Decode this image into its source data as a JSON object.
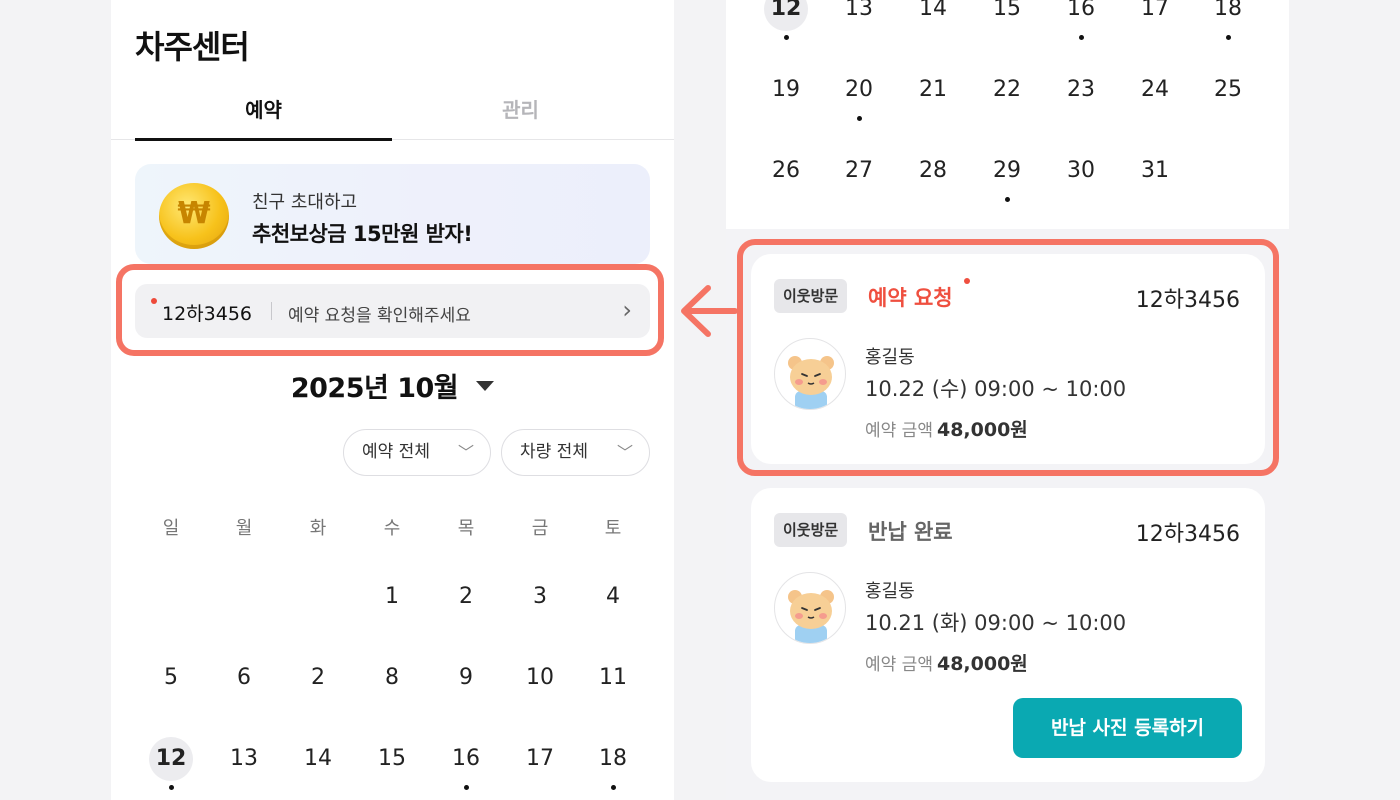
{
  "left": {
    "title": "차주센터",
    "tabs": [
      {
        "label": "예약",
        "active": true
      },
      {
        "label": "관리",
        "active": false
      }
    ],
    "promo": {
      "line1": "친구 초대하고",
      "line2": "추천보상금 15만원 받자!",
      "coin_symbol": "₩"
    },
    "notice": {
      "plate": "12하3456",
      "message": "예약 요청을 확인해주세요",
      "chevron": "›"
    },
    "month": "2025년 10월",
    "filters": [
      {
        "label": "예약 전체"
      },
      {
        "label": "차량 전체"
      }
    ],
    "weekdays": [
      "일",
      "월",
      "화",
      "수",
      "목",
      "금",
      "토"
    ],
    "calendar_rows": [
      [
        null,
        null,
        null,
        "1",
        "2",
        "3",
        "4"
      ],
      [
        "5",
        "6",
        "2",
        "8",
        "9",
        "10",
        "11"
      ],
      [
        "12",
        "13",
        "14",
        "15",
        "16",
        "17",
        "18"
      ]
    ],
    "today": "12",
    "dotted_days": [
      "12",
      "16",
      "18"
    ]
  },
  "right": {
    "calendar_rows": [
      [
        "12",
        "13",
        "14",
        "15",
        "16",
        "17",
        "18"
      ],
      [
        "19",
        "20",
        "21",
        "22",
        "23",
        "24",
        "25"
      ],
      [
        "26",
        "27",
        "28",
        "29",
        "30",
        "31",
        null
      ]
    ],
    "today": "12",
    "dotted_days": [
      "12",
      "16",
      "18",
      "20",
      "29"
    ],
    "reservations": [
      {
        "badge": "이웃방문",
        "status": "예약 요청",
        "status_color": "#ef4f3f",
        "plate": "12하3456",
        "guest": "홍길동",
        "datetime": "10.22 (수) 09:00 ~ 10:00",
        "price_label": "예약 금액",
        "price": "48,000원"
      },
      {
        "badge": "이웃방문",
        "status": "반납 완료",
        "status_color": "#666666",
        "plate": "12하3456",
        "guest": "홍길동",
        "datetime": "10.21 (화) 09:00 ~ 10:00",
        "price_label": "예약 금액",
        "price": "48,000원",
        "action": "반납 사진 등록하기"
      }
    ]
  },
  "colors": {
    "accent_teal": "#0aa9b2",
    "alert_red": "#ef4f3f",
    "annotation_coral": "#f57464"
  }
}
